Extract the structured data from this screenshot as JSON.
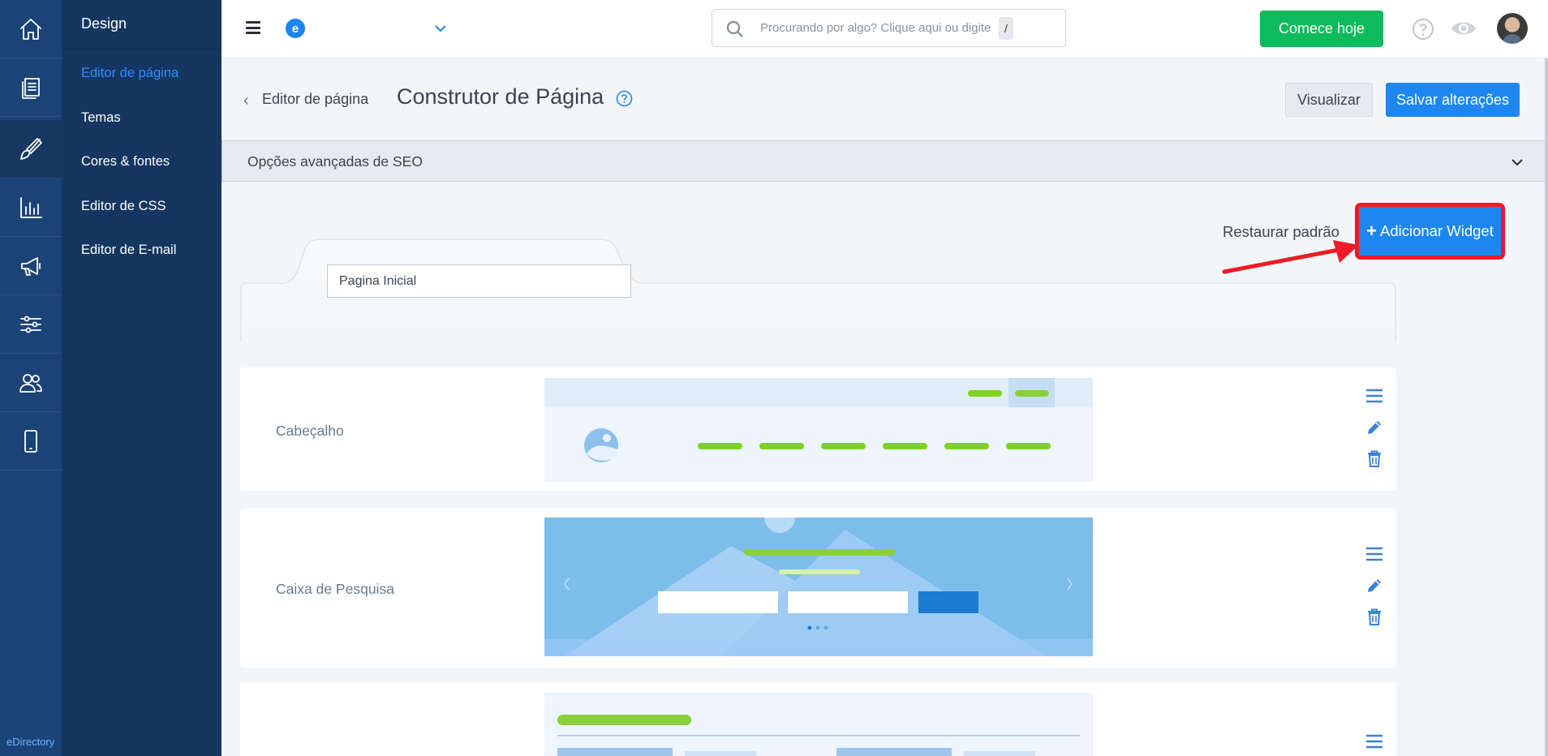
{
  "brand": {
    "footer": "eDirectory",
    "logo_letter": "e"
  },
  "rail": {
    "items": [
      {
        "name": "home-icon"
      },
      {
        "name": "pages-icon"
      },
      {
        "name": "brush-icon",
        "active": true
      },
      {
        "name": "chart-icon"
      },
      {
        "name": "megaphone-icon"
      },
      {
        "name": "sliders-icon"
      },
      {
        "name": "users-icon"
      },
      {
        "name": "mobile-icon"
      }
    ]
  },
  "sidebar": {
    "title": "Design",
    "items": [
      {
        "label": "Editor de página",
        "active": true
      },
      {
        "label": "Temas"
      },
      {
        "label": "Cores & fontes"
      },
      {
        "label": "Editor de CSS"
      },
      {
        "label": "Editor de E-mail"
      }
    ]
  },
  "topbar": {
    "search_placeholder": "Procurando por algo? Clique aqui ou digite",
    "search_shortcut": "/",
    "cta_label": "Comece hoje"
  },
  "header": {
    "breadcrumb": "Editor de página",
    "title": "Construtor de Página",
    "preview_label": "Visualizar",
    "save_label": "Salvar alterações"
  },
  "seo": {
    "label": "Opções avançadas de SEO"
  },
  "builder": {
    "restore_label": "Restaurar padrão",
    "add_widget_label": "Adicionar Widget",
    "page_name_value": "Pagina Inicial"
  },
  "widgets": [
    {
      "label": "Cabeçalho"
    },
    {
      "label": "Caixa de Pesquisa"
    },
    {
      "label": ""
    }
  ],
  "colors": {
    "accent": "#1e87ef",
    "cta": "#0dbb5c",
    "highlight": "#ee1b24",
    "rail": "#1a4478",
    "sidebar": "#143660"
  }
}
